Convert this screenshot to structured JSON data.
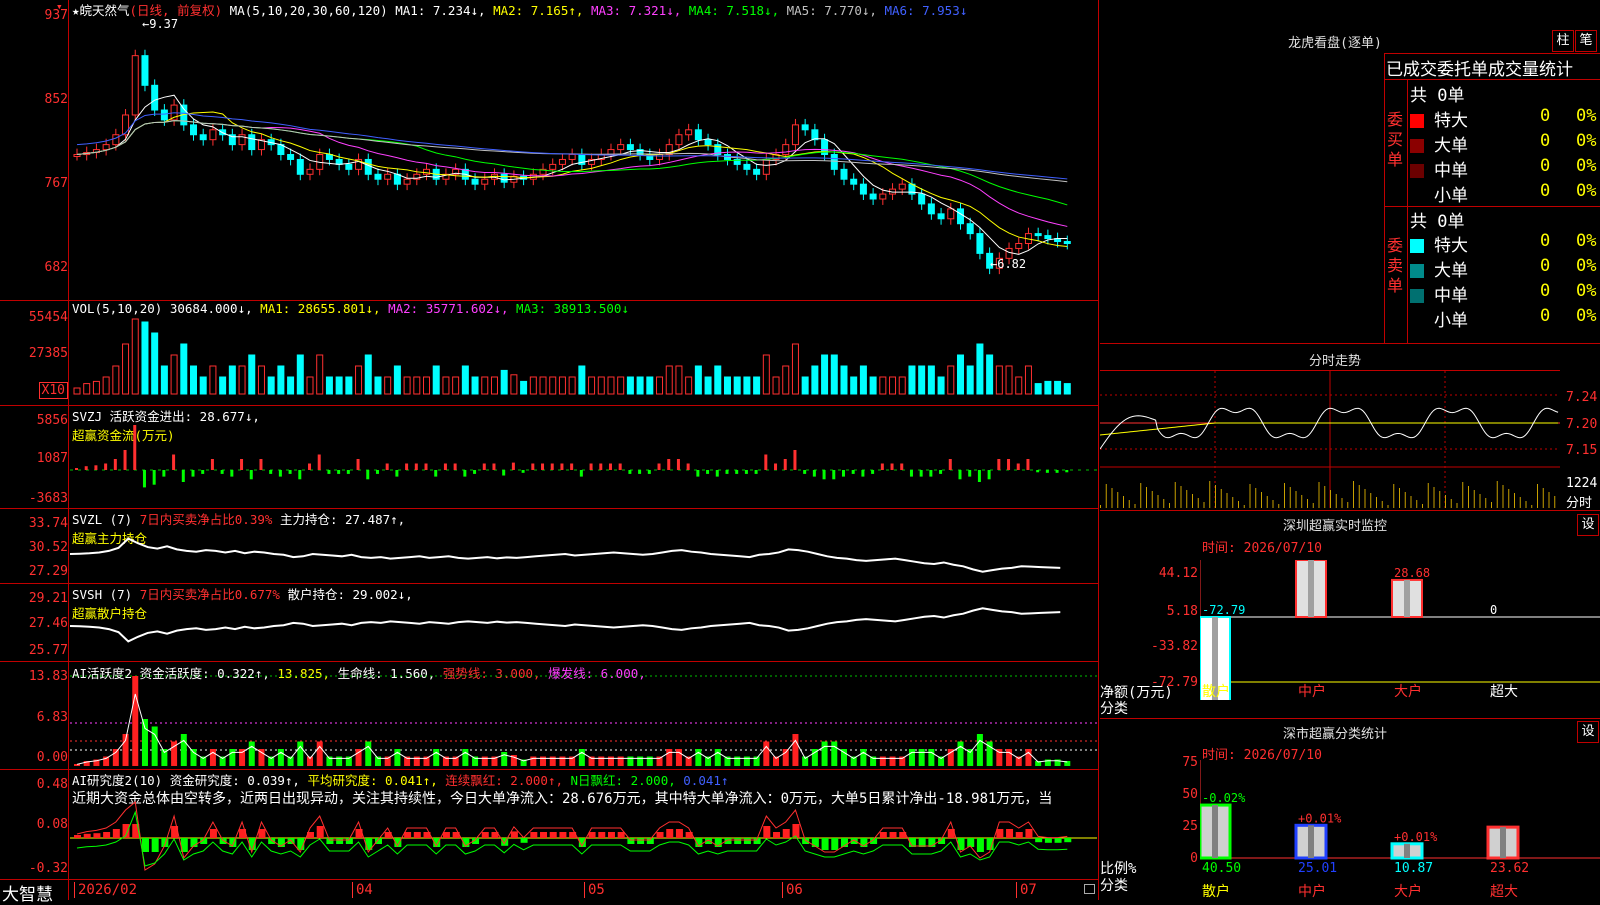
{
  "stock_title": "★皖天然气",
  "period_label": "(日线, 前复权)",
  "ma_header": {
    "params": "MA(5,10,20,30,60,120)",
    "items": [
      {
        "label": "MA1: 7.234↓,",
        "color": "#ffffff"
      },
      {
        "label": "MA2: 7.165↑,",
        "color": "#ffff00"
      },
      {
        "label": "MA3: 7.321↓,",
        "color": "#ff40ff"
      },
      {
        "label": "MA4: 7.518↓,",
        "color": "#00ff00"
      },
      {
        "label": "MA5: 7.770↓,",
        "color": "#c0c0c0"
      },
      {
        "label": "MA6: 7.953↓",
        "color": "#4060ff"
      }
    ]
  },
  "price_ticks": [
    "937",
    "852",
    "767",
    "682"
  ],
  "price_high_label": "←9.37",
  "price_low_label": "←6.82",
  "vol_header": {
    "params": "VOL(5,10,20)",
    "value": "30684.000↓,",
    "items": [
      {
        "label": "MA1: 28655.801↓,",
        "color": "#ffff00"
      },
      {
        "label": "MA2: 35771.602↓,",
        "color": "#ff40ff"
      },
      {
        "label": "MA3: 38913.500↓",
        "color": "#00ff00"
      }
    ]
  },
  "vol_ticks": [
    "55454",
    "27385"
  ],
  "vol_unit": "X10",
  "svzj": {
    "line1": "SVZJ  活跃资金进出: 28.677↓,",
    "line2": "超赢资金流(万元)",
    "ticks": [
      "5856",
      "1087",
      "-3683"
    ]
  },
  "svzl": {
    "name": "SVZL (7)",
    "label_red": "7日内买卖净占比0.39%",
    "label_white": "主力持仓: 27.487↑,",
    "line2": "超赢主力持仓",
    "ticks": [
      "33.74",
      "30.52",
      "27.29"
    ]
  },
  "svsh": {
    "name": "SVSH (7)",
    "label_red": "7日内买卖净占比0.677%",
    "label_white": "散户持仓: 29.002↓,",
    "line2": "超赢散户持仓",
    "ticks": [
      "29.21",
      "27.46",
      "25.77"
    ]
  },
  "ai_active": {
    "items": [
      {
        "label": "AI活跃度2",
        "color": "#ffffff"
      },
      {
        "label": "资金活跃度: 0.322↑,",
        "color": "#ffffff"
      },
      {
        "label": "13.825,",
        "color": "#ffff00"
      },
      {
        "label": "生命线: 1.560,",
        "color": "#ffffff"
      },
      {
        "label": "强势线: 3.000,",
        "color": "#ff3030"
      },
      {
        "label": "爆发线: 6.000,",
        "color": "#ff40ff"
      }
    ],
    "ticks": [
      "13.83",
      "6.83",
      "0.00"
    ]
  },
  "ai_research": {
    "items": [
      {
        "label": "AI研究度2(10)",
        "color": "#ffffff"
      },
      {
        "label": "资金研究度: 0.039↑,",
        "color": "#ffffff"
      },
      {
        "label": "平均研究度: 0.041↑,",
        "color": "#ffff00"
      },
      {
        "label": "连续飘红: 2.000↑,",
        "color": "#ff3030"
      },
      {
        "label": "N日飘红: 2.000,",
        "color": "#00ff00"
      },
      {
        "label": "0.041↑",
        "color": "#4060ff"
      }
    ],
    "comment": "近期大资金总体由空转多，近两日出现异动，关注其持续性，今日大单净流入：28.676万元，其中特大单净流入：0万元，大单5日累计净出-18.981万元，当",
    "ticks": [
      "0.48",
      "0.08",
      "-0.32"
    ]
  },
  "date_axis": {
    "logo": "大智慧",
    "labels": [
      "2026/02",
      "04",
      "05",
      "06",
      "07"
    ]
  },
  "right": {
    "dragon_title": "龙虎看盘(逐单)",
    "btn_zhu": "柱",
    "btn_bi": "笔",
    "stat_title": "已成交委托单成交量统计",
    "buy_side_label": "委买单",
    "sell_side_label": "委卖单",
    "buy_total": "共 0单",
    "sell_total": "共 0单",
    "buy_rows": [
      {
        "label": "特大",
        "value": "0",
        "pct": "0%",
        "color": "#ff0000"
      },
      {
        "label": "大单",
        "value": "0",
        "pct": "0%",
        "color": "#8b0000"
      },
      {
        "label": "中单",
        "value": "0",
        "pct": "0%",
        "color": "#6b0000"
      },
      {
        "label": "小单",
        "value": "0",
        "pct": "0%",
        "color": "#000000"
      }
    ],
    "sell_rows": [
      {
        "label": "特大",
        "value": "0",
        "pct": "0%",
        "color": "#00ffff"
      },
      {
        "label": "大单",
        "value": "0",
        "pct": "0%",
        "color": "#008b8b"
      },
      {
        "label": "中单",
        "value": "0",
        "pct": "0%",
        "color": "#007070"
      },
      {
        "label": "小单",
        "value": "0",
        "pct": "0%",
        "color": "#000000"
      }
    ],
    "intraday_title": "分时走势",
    "intraday_ticks": [
      "7.24",
      "7.20",
      "7.15"
    ],
    "intraday_vol_tick": "1224",
    "intraday_vol_unit": "分时",
    "monitor": {
      "title": "深圳超赢实时监控",
      "btn": "设",
      "time": "时间: 2026/07/10",
      "ticks": [
        "44.12",
        "5.18",
        "-33.82",
        "-72.79"
      ],
      "unit_label": "净额(万元)",
      "cat_label": "分类",
      "categories": [
        {
          "name": "散户",
          "value": -72.79,
          "label": "-72.79",
          "cat_color": "#ffff00",
          "label_color": "#00ffff"
        },
        {
          "name": "中户",
          "value": 44.12,
          "label": "44.12",
          "cat_color": "#ff3030",
          "label_color": "#ff3030"
        },
        {
          "name": "大户",
          "value": 28.68,
          "label": "28.68",
          "cat_color": "#ff3030",
          "label_color": "#ff3030"
        },
        {
          "name": "超大",
          "value": 0,
          "label": "0",
          "cat_color": "#ffffff",
          "label_color": "#ffffff"
        }
      ]
    },
    "classify": {
      "title": "深市超赢分类统计",
      "btn": "设",
      "time": "时间: 2026/07/10",
      "ticks": [
        "75",
        "50",
        "25",
        "0"
      ],
      "unit_label": "比例%",
      "cat_label": "分类",
      "categories": [
        {
          "name": "散户",
          "value": 40.5,
          "label": "40.50",
          "change": "-0.02%",
          "cat_color": "#ffff00",
          "change_color": "#00ff00",
          "value_color": "#00ff00",
          "bar_color": "#00ff00"
        },
        {
          "name": "中户",
          "value": 25.01,
          "label": "25.01",
          "change": "+0.01%",
          "cat_color": "#ff3030",
          "change_color": "#ff3030",
          "value_color": "#2040ff",
          "bar_color": "#2040ff"
        },
        {
          "name": "大户",
          "value": 10.87,
          "label": "10.87",
          "change": "+0.01%",
          "cat_color": "#ff3030",
          "change_color": "#ff3030",
          "value_color": "#00ffff",
          "bar_color": "#00ffff"
        },
        {
          "name": "超大",
          "value": 23.62,
          "label": "23.62",
          "change": "",
          "cat_color": "#ff3030",
          "change_color": "#ff3030",
          "value_color": "#ff3030",
          "bar_color": "#ff3030"
        }
      ]
    }
  },
  "chart_data": {
    "type": "candlestick",
    "x_start": "2026/02",
    "x_labels": [
      "2026/02",
      "04",
      "05",
      "06",
      "07"
    ],
    "ylim": [
      6.82,
      9.37
    ],
    "high": 9.37,
    "low": 6.82,
    "close_series": [
      8.1,
      8.12,
      8.15,
      8.2,
      8.3,
      8.5,
      9.1,
      8.8,
      8.55,
      8.45,
      8.6,
      8.4,
      8.3,
      8.25,
      8.35,
      8.3,
      8.2,
      8.3,
      8.15,
      8.25,
      8.2,
      8.1,
      8.05,
      7.9,
      7.95,
      8.1,
      8.05,
      8.0,
      7.95,
      8.05,
      7.9,
      7.85,
      7.9,
      7.8,
      7.85,
      7.9,
      7.95,
      7.85,
      7.9,
      7.95,
      7.85,
      7.8,
      7.85,
      7.9,
      7.82,
      7.88,
      7.85,
      7.9,
      7.95,
      8.0,
      8.05,
      8.1,
      8.0,
      8.05,
      8.1,
      8.15,
      8.2,
      8.15,
      8.1,
      8.05,
      8.1,
      8.2,
      8.3,
      8.35,
      8.25,
      8.2,
      8.1,
      8.05,
      8.0,
      7.95,
      7.9,
      8.05,
      8.1,
      8.2,
      8.4,
      8.35,
      8.25,
      8.1,
      7.95,
      7.85,
      7.8,
      7.7,
      7.65,
      7.7,
      7.75,
      7.8,
      7.7,
      7.6,
      7.5,
      7.45,
      7.55,
      7.4,
      7.3,
      7.1,
      6.95,
      7.05,
      7.15,
      7.2,
      7.3,
      7.28,
      7.25,
      7.22,
      7.2
    ]
  }
}
